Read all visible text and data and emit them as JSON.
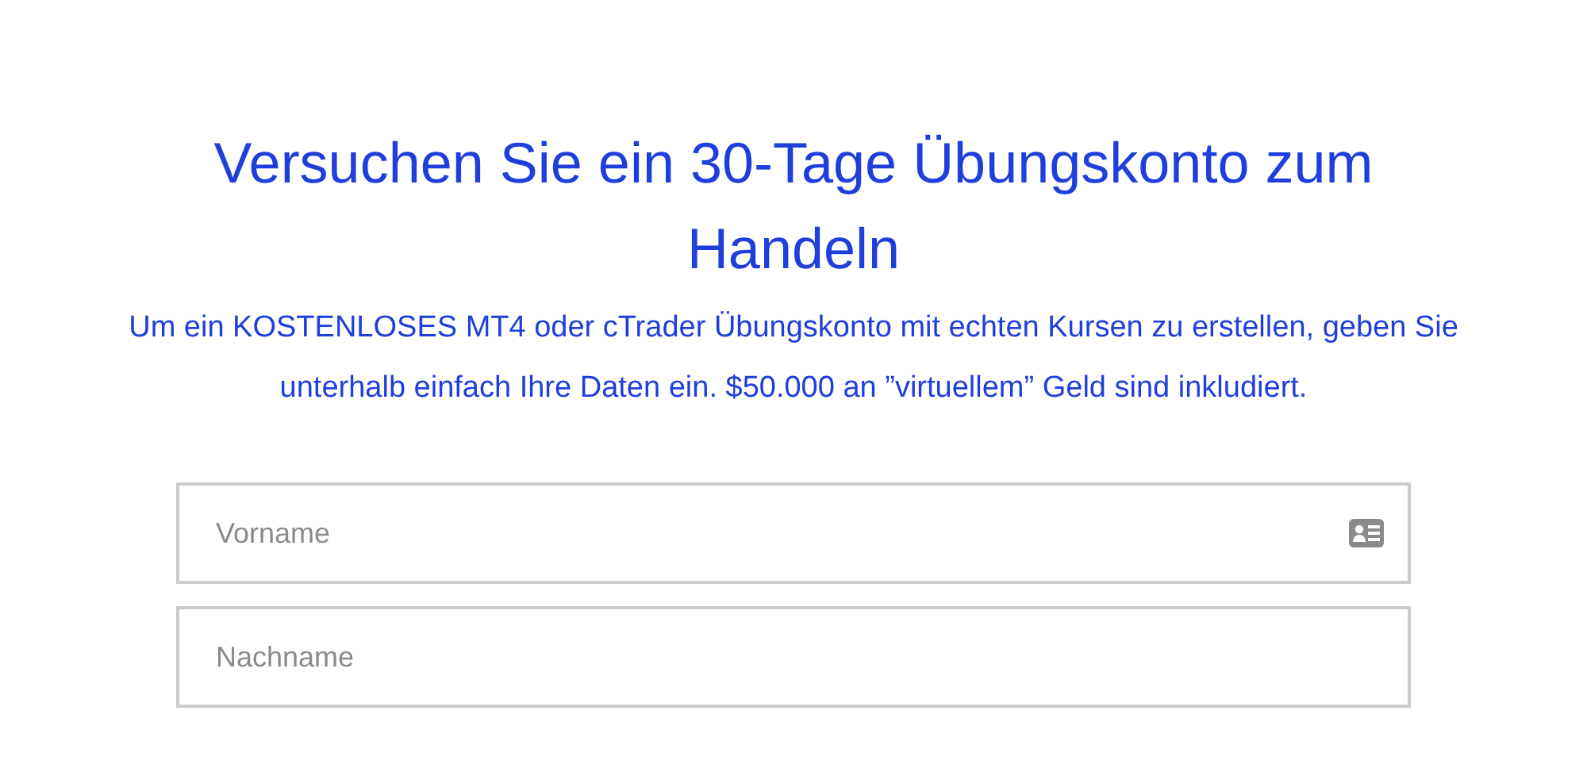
{
  "heading": "Versuchen Sie ein 30-Tage Übungskonto zum Handeln",
  "intro": "Um ein KOSTENLOSES MT4 oder cTrader Übungskonto mit echten Kursen zu erstellen, geben Sie unterhalb einfach Ihre Daten ein. $50.000 an ”virtuellem” Geld sind inkludiert.",
  "fields": [
    {
      "placeholder": "Vorname",
      "kind": "contact"
    },
    {
      "placeholder": "Nachname",
      "kind": "plain"
    }
  ]
}
